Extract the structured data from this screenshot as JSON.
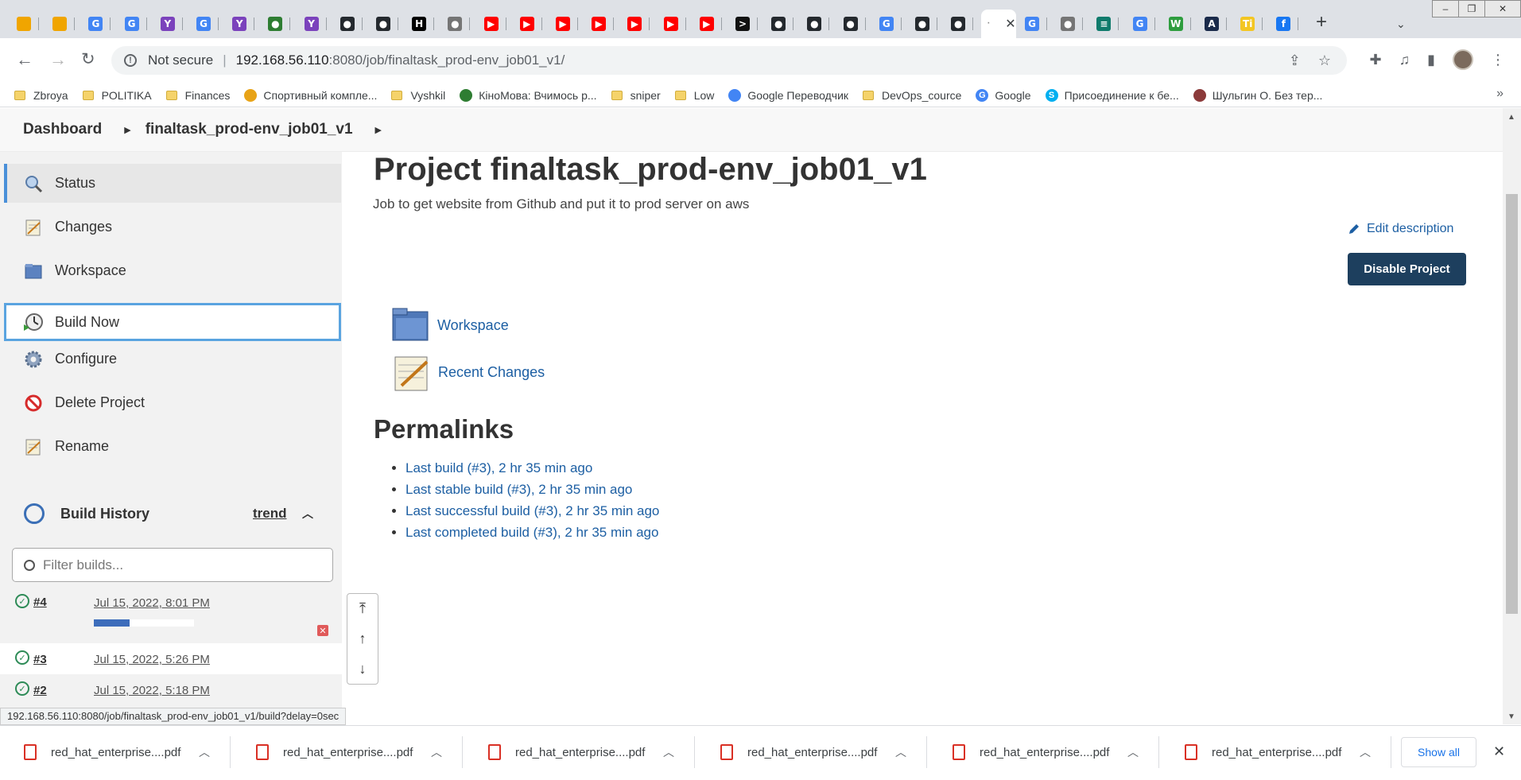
{
  "browser": {
    "tabs": [
      {
        "icon": "box-icon",
        "color": "#f0a500",
        "glyph": ""
      },
      {
        "icon": "box-icon",
        "color": "#f0a500",
        "glyph": ""
      },
      {
        "icon": "google-icon",
        "color": "#4285f4",
        "glyph": "G"
      },
      {
        "icon": "google-icon",
        "color": "#4285f4",
        "glyph": "G"
      },
      {
        "icon": "terraform-icon",
        "color": "#7b42bc",
        "glyph": "Y"
      },
      {
        "icon": "google-icon",
        "color": "#4285f4",
        "glyph": "G"
      },
      {
        "icon": "terraform-icon",
        "color": "#7b42bc",
        "glyph": "Y"
      },
      {
        "icon": "globe-icon",
        "color": "#2e7d32",
        "glyph": "●"
      },
      {
        "icon": "terraform-icon",
        "color": "#7b42bc",
        "glyph": "Y"
      },
      {
        "icon": "github-icon",
        "color": "#24292e",
        "glyph": "●"
      },
      {
        "icon": "github-icon",
        "color": "#24292e",
        "glyph": "●"
      },
      {
        "icon": "hashicorp-icon",
        "color": "#000000",
        "glyph": "H"
      },
      {
        "icon": "globe-icon",
        "color": "#757575",
        "glyph": "●"
      },
      {
        "icon": "youtube-icon",
        "color": "#ff0000",
        "glyph": "▶"
      },
      {
        "icon": "youtube-icon",
        "color": "#ff0000",
        "glyph": "▶"
      },
      {
        "icon": "youtube-icon",
        "color": "#ff0000",
        "glyph": "▶"
      },
      {
        "icon": "youtube-icon",
        "color": "#ff0000",
        "glyph": "▶"
      },
      {
        "icon": "youtube-icon",
        "color": "#ff0000",
        "glyph": "▶"
      },
      {
        "icon": "youtube-icon",
        "color": "#ff0000",
        "glyph": "▶"
      },
      {
        "icon": "youtube-icon",
        "color": "#ff0000",
        "glyph": "▶"
      },
      {
        "icon": "terminal-icon",
        "color": "#111111",
        "glyph": ">"
      },
      {
        "icon": "github-icon",
        "color": "#24292e",
        "glyph": "●"
      },
      {
        "icon": "github-icon",
        "color": "#24292e",
        "glyph": "●"
      },
      {
        "icon": "github-icon",
        "color": "#24292e",
        "glyph": "●"
      },
      {
        "icon": "google-icon",
        "color": "#4285f4",
        "glyph": "G"
      },
      {
        "icon": "github-icon",
        "color": "#24292e",
        "glyph": "●"
      },
      {
        "icon": "github-icon",
        "color": "#24292e",
        "glyph": "●"
      }
    ],
    "tabs_after": [
      {
        "icon": "google-icon",
        "color": "#4285f4",
        "glyph": "G"
      },
      {
        "icon": "globe-icon",
        "color": "#757575",
        "glyph": "●"
      },
      {
        "icon": "sheets-icon",
        "color": "#0f7b6c",
        "glyph": "≡"
      },
      {
        "icon": "google-icon",
        "color": "#4285f4",
        "glyph": "G"
      },
      {
        "icon": "w-icon",
        "color": "#2e9d3e",
        "glyph": "W"
      },
      {
        "icon": "arch-icon",
        "color": "#1a2a4a",
        "glyph": "A"
      },
      {
        "icon": "ti-icon",
        "color": "#f3c623",
        "glyph": "Ti"
      },
      {
        "icon": "facebook-icon",
        "color": "#1877f2",
        "glyph": "f"
      }
    ],
    "address": {
      "security_label": "Not secure",
      "host": "192.168.56.110",
      "path": ":8080/job/finaltask_prod-env_job01_v1/"
    },
    "bookmarks": [
      {
        "label": "Zbroya",
        "type": "folder"
      },
      {
        "label": "POLITIKA",
        "type": "folder"
      },
      {
        "label": "Finances",
        "type": "folder"
      },
      {
        "label": "Спортивный компле...",
        "type": "house"
      },
      {
        "label": "Vyshkil",
        "type": "folder"
      },
      {
        "label": "КіноМова: Вчимось р...",
        "type": "bars"
      },
      {
        "label": "sniper",
        "type": "folder"
      },
      {
        "label": "Low",
        "type": "folder"
      },
      {
        "label": "Google Переводчик",
        "type": "translate"
      },
      {
        "label": "DevOps_cource",
        "type": "folder"
      },
      {
        "label": "Google",
        "type": "google"
      },
      {
        "label": "Присоединение к бе...",
        "type": "skype"
      },
      {
        "label": "Шульгин О. Без тер...",
        "type": "flag"
      }
    ]
  },
  "jenkins": {
    "breadcrumbs": {
      "root": "Dashboard",
      "job": "finaltask_prod-env_job01_v1"
    },
    "sidebar": [
      {
        "label": "Status",
        "icon": "search-icon"
      },
      {
        "label": "Changes",
        "icon": "notepad-icon"
      },
      {
        "label": "Workspace",
        "icon": "folder-icon"
      },
      {
        "label": "Build Now",
        "icon": "clock-icon"
      },
      {
        "label": "Configure",
        "icon": "gear-icon"
      },
      {
        "label": "Delete Project",
        "icon": "no-entry-icon"
      },
      {
        "label": "Rename",
        "icon": "notepad-icon"
      }
    ],
    "build_history": {
      "title": "Build History",
      "trend": "trend",
      "filter_placeholder": "Filter builds...",
      "builds": [
        {
          "number": "#4",
          "date": "Jul 15, 2022, 8:01 PM",
          "in_progress": true,
          "progress": 0.36
        },
        {
          "number": "#3",
          "date": "Jul 15, 2022, 5:26 PM",
          "in_progress": false
        },
        {
          "number": "#2",
          "date": "Jul 15, 2022, 5:18 PM",
          "in_progress": false
        }
      ]
    },
    "project": {
      "title": "Project finaltask_prod-env_job01_v1",
      "description": "Job to get website from Github and put it to prod server on aws",
      "edit_description": "Edit description",
      "disable_button": "Disable Project",
      "links": {
        "workspace": "Workspace",
        "recent_changes": "Recent Changes"
      },
      "permalinks_title": "Permalinks",
      "permalinks": [
        "Last build (#3), 2 hr 35 min ago",
        "Last stable build (#3), 2 hr 35 min ago",
        "Last successful build (#3), 2 hr 35 min ago",
        "Last completed build (#3), 2 hr 35 min ago"
      ]
    },
    "status_url": "192.168.56.110:8080/job/finaltask_prod-env_job01_v1/build?delay=0sec"
  },
  "downloads": {
    "items": [
      "red_hat_enterprise....pdf",
      "red_hat_enterprise....pdf",
      "red_hat_enterprise....pdf",
      "red_hat_enterprise....pdf",
      "red_hat_enterprise....pdf",
      "red_hat_enterprise....pdf"
    ],
    "show_all": "Show all"
  }
}
